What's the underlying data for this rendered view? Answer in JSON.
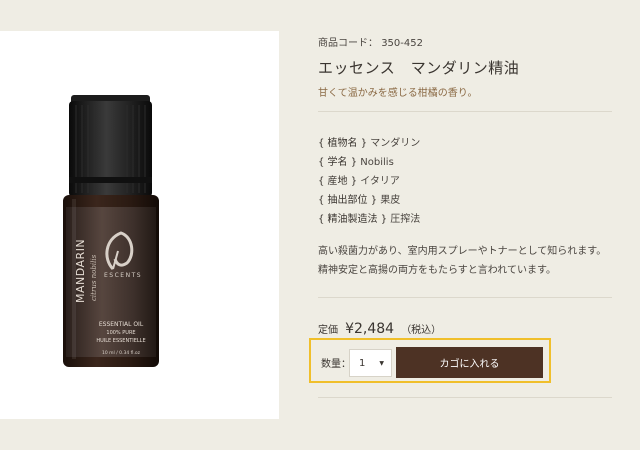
{
  "product": {
    "code_label": "商品コード：",
    "code": "350-452",
    "title": "エッセンス　マンダリン精油",
    "tagline": "甘くて温かみを感じる柑橘の香り。",
    "specs": [
      {
        "key": "{ 植物名 }",
        "value": "マンダリン"
      },
      {
        "key": "{ 学名 }",
        "value": "Nobilis"
      },
      {
        "key": "{ 産地 }",
        "value": "イタリア"
      },
      {
        "key": "{ 抽出部位 }",
        "value": "果皮"
      },
      {
        "key": "{ 精油製造法 }",
        "value": "圧搾法"
      }
    ],
    "description_lines": [
      "高い殺菌力があり、室内用スプレーやトナーとして知られます。",
      "精神安定と高揚の両方をもたらすと言われています。"
    ],
    "price_label": "定価",
    "price": "¥2,484",
    "price_tax": "（税込）"
  },
  "purchase": {
    "qty_label": "数量：",
    "qty_value": "1",
    "cart_button_label": "カゴに入れる"
  },
  "bottle_label": {
    "brand": "ESCENTS",
    "name": "MANDARIN",
    "latin": "citrus nobilis",
    "line1": "ESSENTIAL OIL",
    "line2": "100% PURE",
    "line3": "HUILE ESSENTIELLE",
    "volume": "10 ml / 0.34 fl.oz"
  },
  "colors": {
    "background": "#efede4",
    "accent_gold": "#f0bf2b",
    "button_brown": "#4d3224",
    "tagline_brown": "#8b6a45"
  }
}
